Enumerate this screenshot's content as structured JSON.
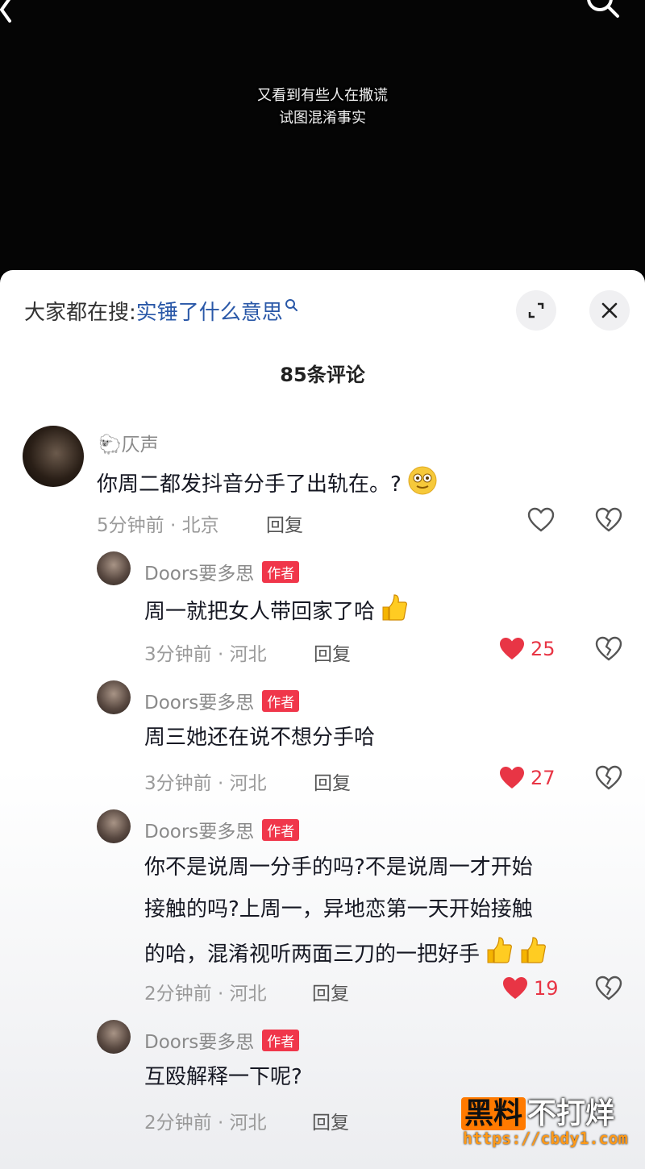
{
  "video": {
    "subtitle_line1": "又看到有些人在撒谎",
    "subtitle_line2": "试图混淆事实"
  },
  "sheet": {
    "hot_search_prefix": "大家都在搜:",
    "hot_search_term": "实锤了什么意思",
    "comment_count": "85条评论"
  },
  "comments": [
    {
      "username": "仄声",
      "text": "你周二都发抖音分手了出轨在。?",
      "time_location": "5分钟前 · 北京",
      "reply_label": "回复"
    }
  ],
  "replies": [
    {
      "username": "Doors要多思",
      "badge": "作者",
      "text": "周一就把女人带回家了哈",
      "time_location": "3分钟前 · 河北",
      "reply_label": "回复",
      "likes": "25"
    },
    {
      "username": "Doors要多思",
      "badge": "作者",
      "text": "周三她还在说不想分手哈",
      "time_location": "3分钟前 · 河北",
      "reply_label": "回复",
      "likes": "27"
    },
    {
      "username": "Doors要多思",
      "badge": "作者",
      "text_line1": "你不是说周一分手的吗?不是说周一才开始",
      "text_line2": "接触的吗?上周一，异地恋第一天开始接触",
      "text_line3": "的哈，混淆视听两面三刀的一把好手",
      "time_location": "2分钟前 · 河北",
      "reply_label": "回复",
      "likes": "19"
    },
    {
      "username": "Doors要多思",
      "badge": "作者",
      "text": "互殴解释一下呢?",
      "time_location": "2分钟前 · 河北",
      "reply_label": "回复"
    }
  ],
  "watermark": {
    "brand_a": "黑料",
    "brand_b": "不打烊",
    "url": "https://cbdy1.com"
  },
  "colors": {
    "like_red": "#e83545",
    "badge_red": "#f0364a",
    "search_blue": "#2a58a8",
    "watermark_orange": "#ff7a00"
  }
}
